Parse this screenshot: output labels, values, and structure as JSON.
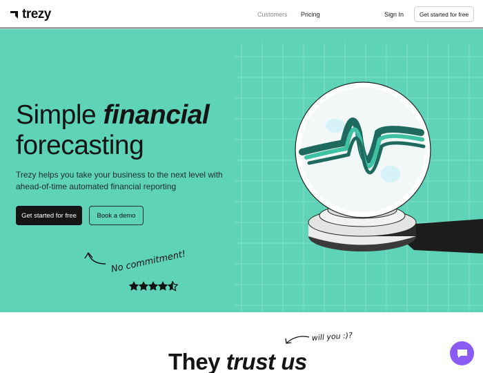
{
  "brand": {
    "name": "trezy"
  },
  "nav": {
    "links": [
      "Customers",
      "Pricing"
    ],
    "sign_in": "Sign In",
    "cta": "Get started for free"
  },
  "hero": {
    "title_part1": "Simple ",
    "title_emphasis": "financial",
    "title_part2": "forecasting",
    "subtitle": "Trezy helps you take your business to the next level with ahead-of-time automated financial reporting",
    "primary_button": "Get started for free",
    "secondary_button": "Book a demo",
    "annotation": "No commitment!",
    "rating_stars": 4.5
  },
  "trust": {
    "title_part1": "They ",
    "title_emphasis": "trust us",
    "annotation": "will you :)?"
  },
  "colors": {
    "hero_background": "#5fd3b7",
    "primary": "#141414",
    "chat": "#8a5cf5"
  },
  "icons": [
    "trezy-logo-icon",
    "crystal-ball-illustration",
    "star-icon",
    "chat-icon"
  ]
}
